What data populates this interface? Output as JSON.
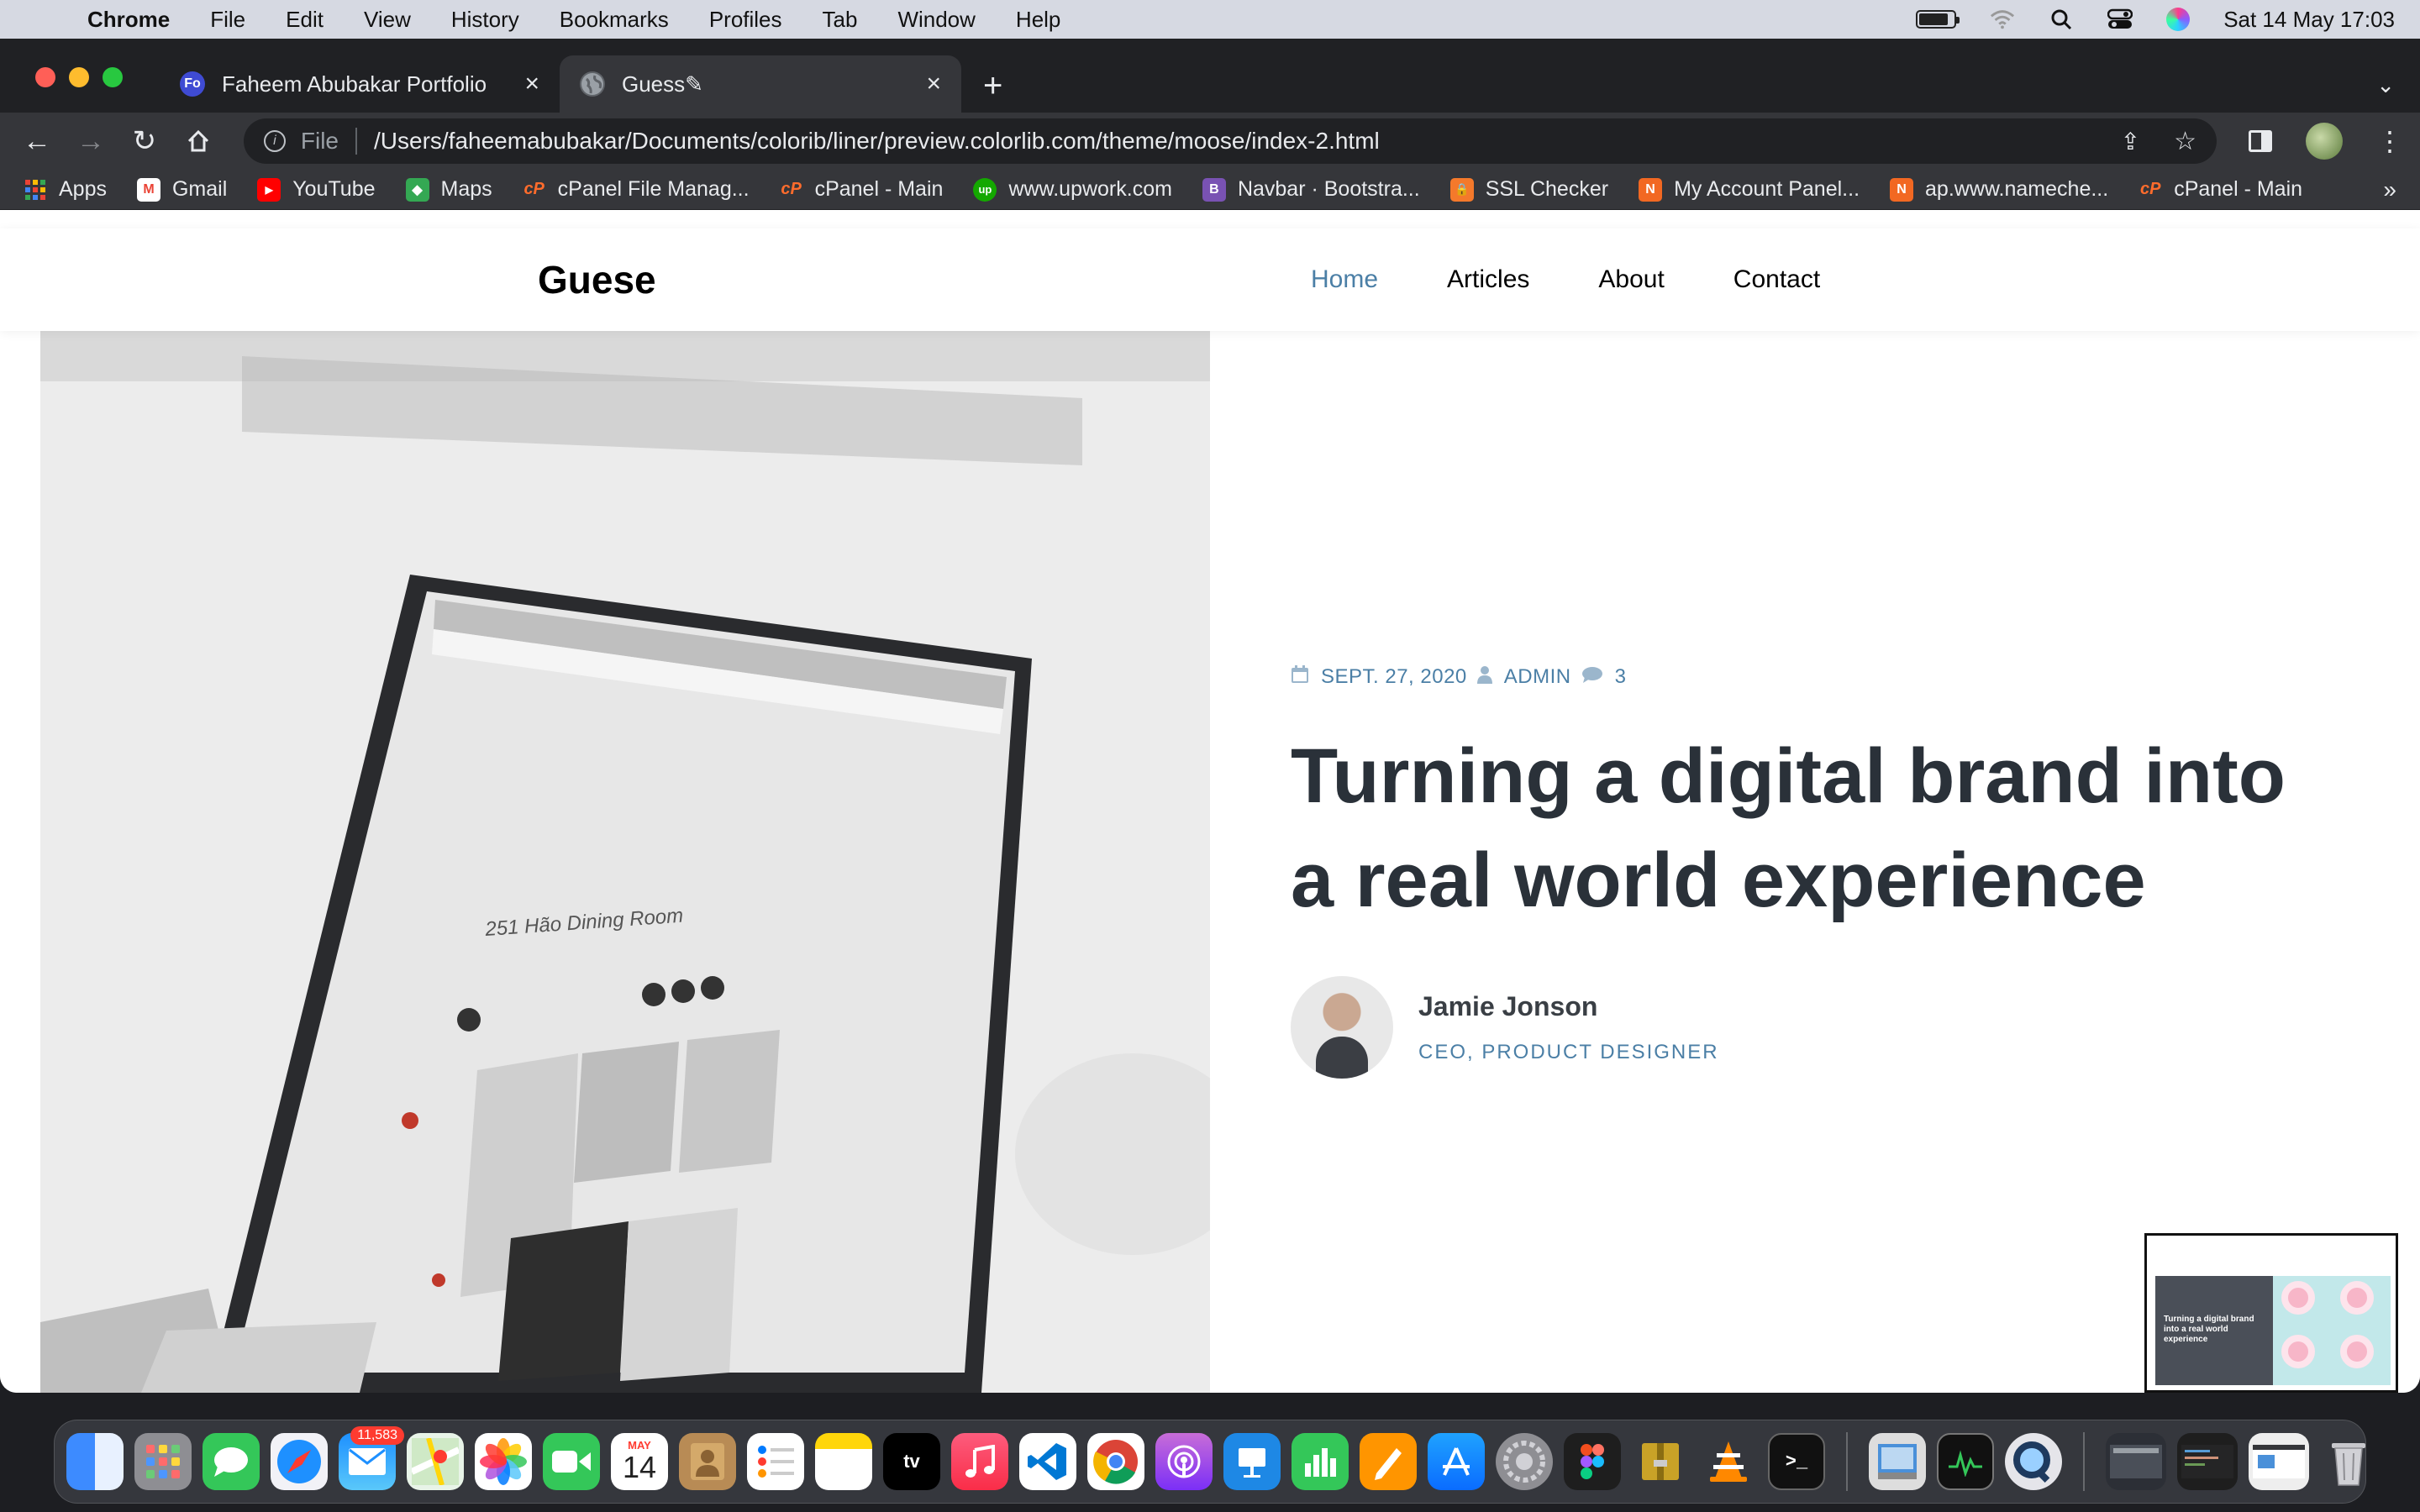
{
  "menubar": {
    "app": "Chrome",
    "items": [
      "File",
      "Edit",
      "View",
      "History",
      "Bookmarks",
      "Profiles",
      "Tab",
      "Window",
      "Help"
    ],
    "datetime": "Sat 14 May  17:03"
  },
  "tabs": [
    {
      "title": "Faheem Abubakar Portfolio",
      "favicon": "Fo"
    },
    {
      "title": "Guess✎"
    }
  ],
  "address": {
    "scheme": "File",
    "url": "/Users/faheemabubakar/Documents/colorib/liner/preview.colorlib.com/theme/moose/index-2.html"
  },
  "bookmarks": [
    {
      "label": "Apps",
      "color": "#4285f4",
      "glyph": ""
    },
    {
      "label": "Gmail",
      "color": "#ea4335",
      "glyph": "M"
    },
    {
      "label": "YouTube",
      "color": "#ff0000",
      "glyph": "▶"
    },
    {
      "label": "Maps",
      "color": "#34a853",
      "glyph": "◆"
    },
    {
      "label": "cPanel File Manag...",
      "color": "#ff6c2c",
      "glyph": "cP"
    },
    {
      "label": "cPanel - Main",
      "color": "#ff6c2c",
      "glyph": "cP"
    },
    {
      "label": "www.upwork.com",
      "color": "#14a800",
      "glyph": "up"
    },
    {
      "label": "Navbar · Bootstra...",
      "color": "#7952b3",
      "glyph": "B"
    },
    {
      "label": "SSL Checker",
      "color": "#f4792b",
      "glyph": "🔒"
    },
    {
      "label": "My Account Panel...",
      "color": "#f26822",
      "glyph": "N"
    },
    {
      "label": "ap.www.nameche...",
      "color": "#f26822",
      "glyph": "N"
    },
    {
      "label": "cPanel - Main",
      "color": "#ff6c2c",
      "glyph": "cP"
    }
  ],
  "site": {
    "logo": "Guese",
    "nav": [
      "Home",
      "Articles",
      "About",
      "Contact"
    ],
    "accent": "#4b7fa6"
  },
  "post": {
    "date": "SEPT. 27, 2020",
    "author_tag": "ADMIN",
    "comments": "3",
    "title": "Turning a digital brand into a real world experience",
    "author_name": "Jamie Jonson",
    "author_role": "CEO, PRODUCT DESIGNER"
  },
  "screen_text": "251 Hão Dining Room",
  "thumbnail": {
    "title": "Turning a digital brand into a real world experience"
  },
  "dock": {
    "mail_badge": "11,583",
    "calendar_month": "MAY",
    "calendar_day": "14",
    "tv_label": "tv"
  }
}
